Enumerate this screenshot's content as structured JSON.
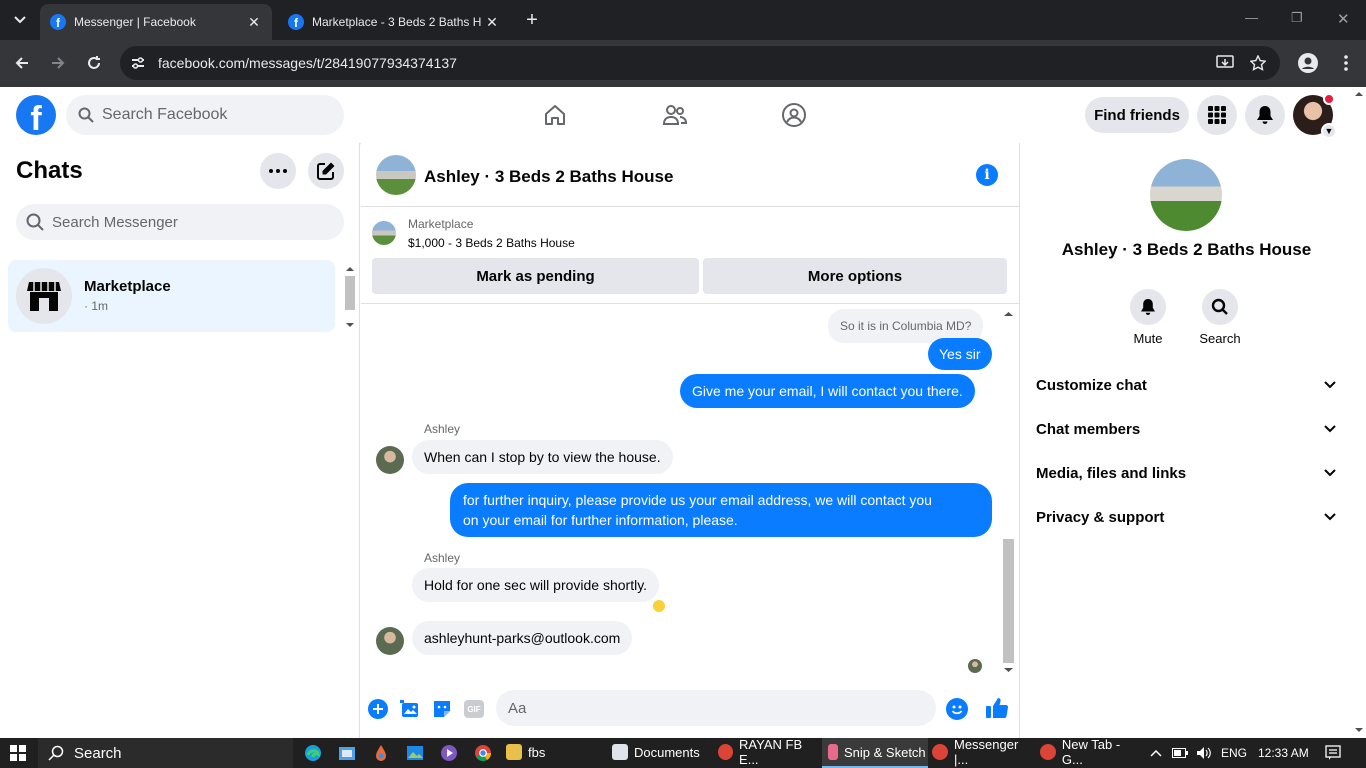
{
  "browser": {
    "tabs": [
      {
        "title": "Messenger | Facebook",
        "active": true
      },
      {
        "title": "Marketplace - 3 Beds 2 Baths H",
        "active": false
      }
    ],
    "url": "facebook.com/messages/t/28419077934374137"
  },
  "fb_header": {
    "logo": "f",
    "search_placeholder": "Search Facebook",
    "find_friends_label": "Find friends",
    "nav_icons": [
      "home-icon",
      "friends-icon",
      "groups-icon"
    ]
  },
  "left_panel": {
    "title": "Chats",
    "search_placeholder": "Search Messenger",
    "chats": [
      {
        "name": "Marketplace",
        "time": "· 1m"
      }
    ]
  },
  "conversation": {
    "name": "Ashley · 3 Beds 2 Baths House",
    "marketplace_label": "Marketplace",
    "listing": "$1,000 - 3 Beds 2 Baths House",
    "mark_pending_label": "Mark as pending",
    "more_options_label": "More options",
    "messages": [
      {
        "dir": "in",
        "text": "So it is in Columbia MD?"
      },
      {
        "dir": "out",
        "text": "Yes sir"
      },
      {
        "dir": "out",
        "text": "Give me your email, I will contact you there."
      },
      {
        "dir": "in",
        "sender": "Ashley",
        "text": "When can I stop by to view the house."
      },
      {
        "dir": "out",
        "text_line1": "for further inquiry, please provide us your email address, we will contact you",
        "text_line2": "on your email for further information, please."
      },
      {
        "dir": "in",
        "sender": "Ashley",
        "text": "Hold for one sec will provide shortly."
      },
      {
        "dir": "in",
        "text": "ashleyhunt-parks@outlook.com"
      }
    ],
    "composer_placeholder": "Aa",
    "gif_label": "GIF"
  },
  "right_panel": {
    "name": "Ashley · 3 Beds 2 Baths House",
    "mute_label": "Mute",
    "search_label": "Search",
    "sections": [
      "Customize chat",
      "Chat members",
      "Media, files and links",
      "Privacy & support"
    ]
  },
  "taskbar": {
    "search_label": "Search",
    "tasks": [
      "fbs",
      "Documents",
      "RAYAN FB E...",
      "Snip & Sketch",
      "Messenger |...",
      "New Tab - G..."
    ],
    "language": "ENG",
    "time": "12:33 AM"
  },
  "colors": {
    "brand": "#1877f2",
    "bubble_out": "#0a7cff",
    "bubble_in": "#f0f2f5"
  }
}
